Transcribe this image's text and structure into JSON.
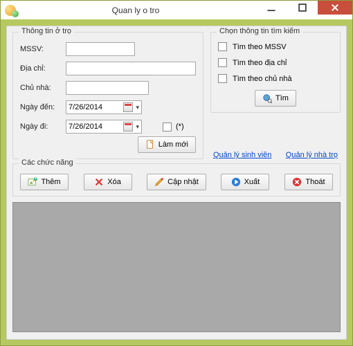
{
  "window": {
    "title": "Quan ly o tro"
  },
  "info": {
    "legend": "Thông tin ở trọ",
    "mssv_label": "MSSV:",
    "mssv_value": "",
    "diachi_label": "Địa chỉ:",
    "diachi_value": "",
    "chunha_label": "Chủ nhà:",
    "chunha_value": "",
    "ngayden_label": "Ngày đến:",
    "ngayden_value": "7/26/2014",
    "ngaydi_label": "Ngày đi:",
    "ngaydi_value": "7/26/2014",
    "star_label": "(*)",
    "lammoi_label": "Làm mới"
  },
  "search": {
    "legend": "Chọn thông tin tìm kiếm",
    "opt_mssv": "Tìm theo MSSV",
    "opt_diachi": "Tìm theo địa chỉ",
    "opt_chunha": "Tìm theo chủ nhà",
    "tim_label": "Tìm"
  },
  "links": {
    "sinhvien": "Quản lý sinh viên",
    "nhatro": "Quản lý nhà trọ"
  },
  "functions": {
    "legend": "Các chức năng",
    "them": "Thêm",
    "xoa": "Xóa",
    "capnhat": "Cập nhật",
    "xuat": "Xuất",
    "thoat": "Thoát"
  }
}
